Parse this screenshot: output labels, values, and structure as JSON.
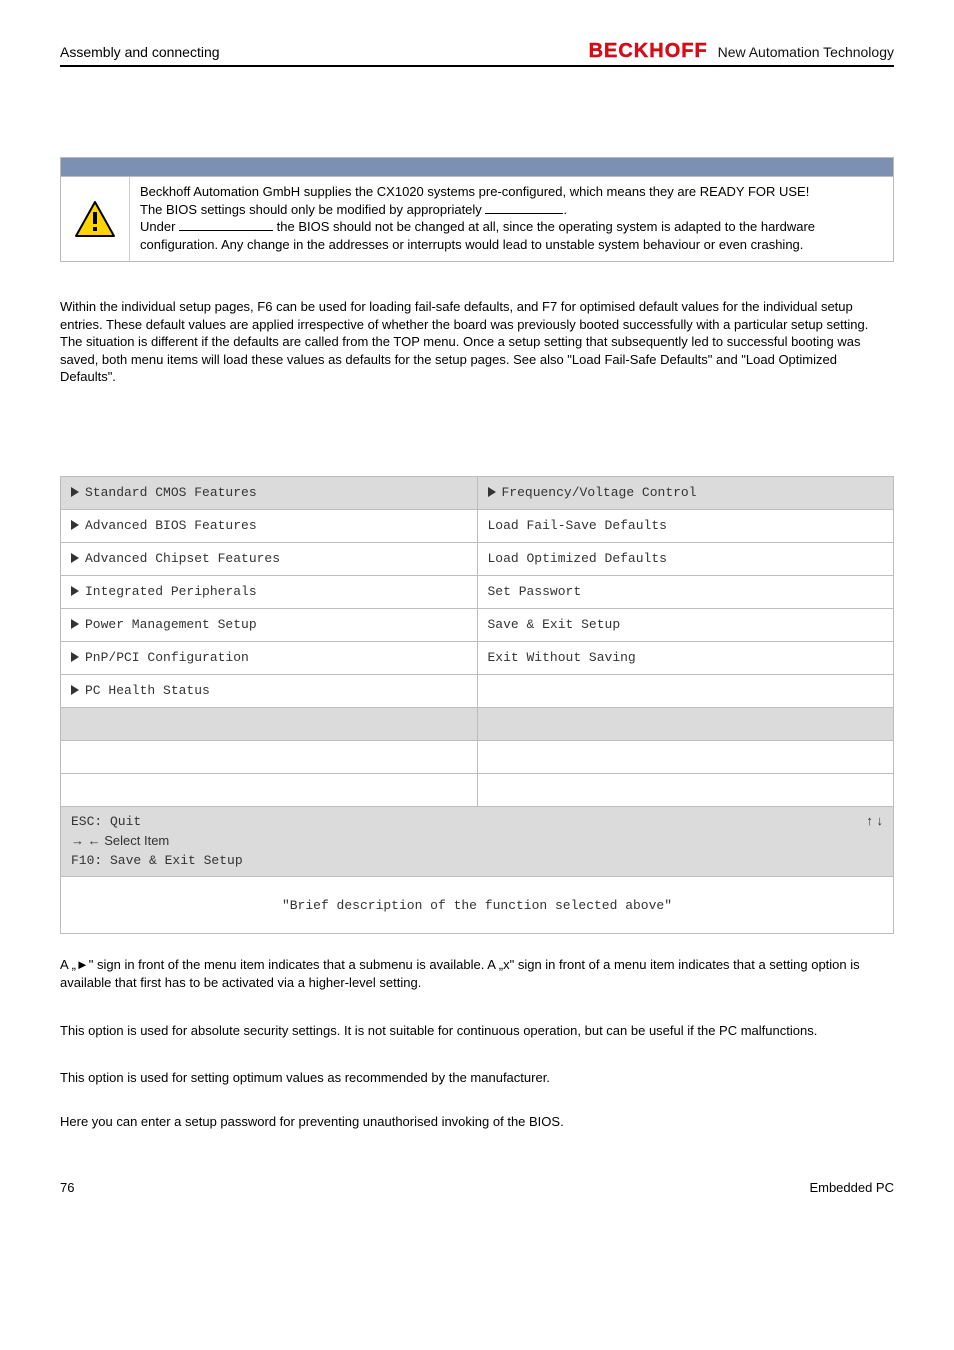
{
  "header": {
    "left": "Assembly and connecting",
    "brand": "BECKHOFF",
    "tagline": "New Automation Technology"
  },
  "warning": {
    "line1a": "Beckhoff Automation GmbH supplies the CX1020 systems pre-configured, which means they are ",
    "line1b": "READY FOR USE!",
    "line2a": "The BIOS settings should only be modified by appropriately ",
    "line2b": ".",
    "line3a": "Under ",
    "line3b": " the BIOS should not be changed at all, since the operating system is adapted to the hardware configuration. Any change in the addresses or interrupts would lead to unstable system behaviour or even crashing."
  },
  "intro_para": "Within the individual setup pages, F6 can be used for loading fail-safe defaults, and F7 for optimised default values for the individual setup entries. These default values are applied irrespective of whether the board was previously booted successfully with a particular setup setting. The situation is different if the defaults are called from the TOP menu. Once a setup setting that subsequently led to successful booting was saved, both menu items will load these values as defaults for the setup pages. See also \"Load Fail-Safe Defaults\" and \"Load Optimized Defaults\".",
  "bios": {
    "left": [
      "Standard CMOS Features",
      "Advanced BIOS Features",
      "Advanced Chipset Features",
      "Integrated Peripherals",
      "Power Management Setup",
      "PnP/PCI Configuration",
      "PC Health Status"
    ],
    "right": [
      "Frequency/Voltage Control",
      "Load Fail-Save Defaults",
      "Load Optimized Defaults",
      "Set Passwort",
      "Save & Exit Setup",
      "Exit Without Saving",
      ""
    ],
    "left_has_arrow": [
      true,
      true,
      true,
      true,
      true,
      true,
      true
    ],
    "right_has_arrow": [
      true,
      false,
      false,
      false,
      false,
      false,
      false
    ],
    "footer_left_l1": "ESC: Quit",
    "footer_left_l2": "→ ← Select Item",
    "footer_left_l3": "F10: Save & Exit Setup",
    "footer_right": "↑  ↓",
    "desc": "\"Brief description of the function selected above\""
  },
  "sections": {
    "submenu_note": "A „►\" sign in front of the menu item indicates that a submenu is available. A „x\" sign in front of a menu item indicates that a setting option is available that first has to be activated via a higher-level setting.",
    "failsafe": "This option is used for absolute security settings. It is not suitable for continuous operation, but can be useful if the PC malfunctions.",
    "optimized": "This option is used for setting optimum values as recommended by the manufacturer.",
    "password": "Here you can enter a setup password for preventing unauthorised invoking of the BIOS."
  },
  "footer": {
    "page": "76",
    "product": "Embedded PC"
  }
}
